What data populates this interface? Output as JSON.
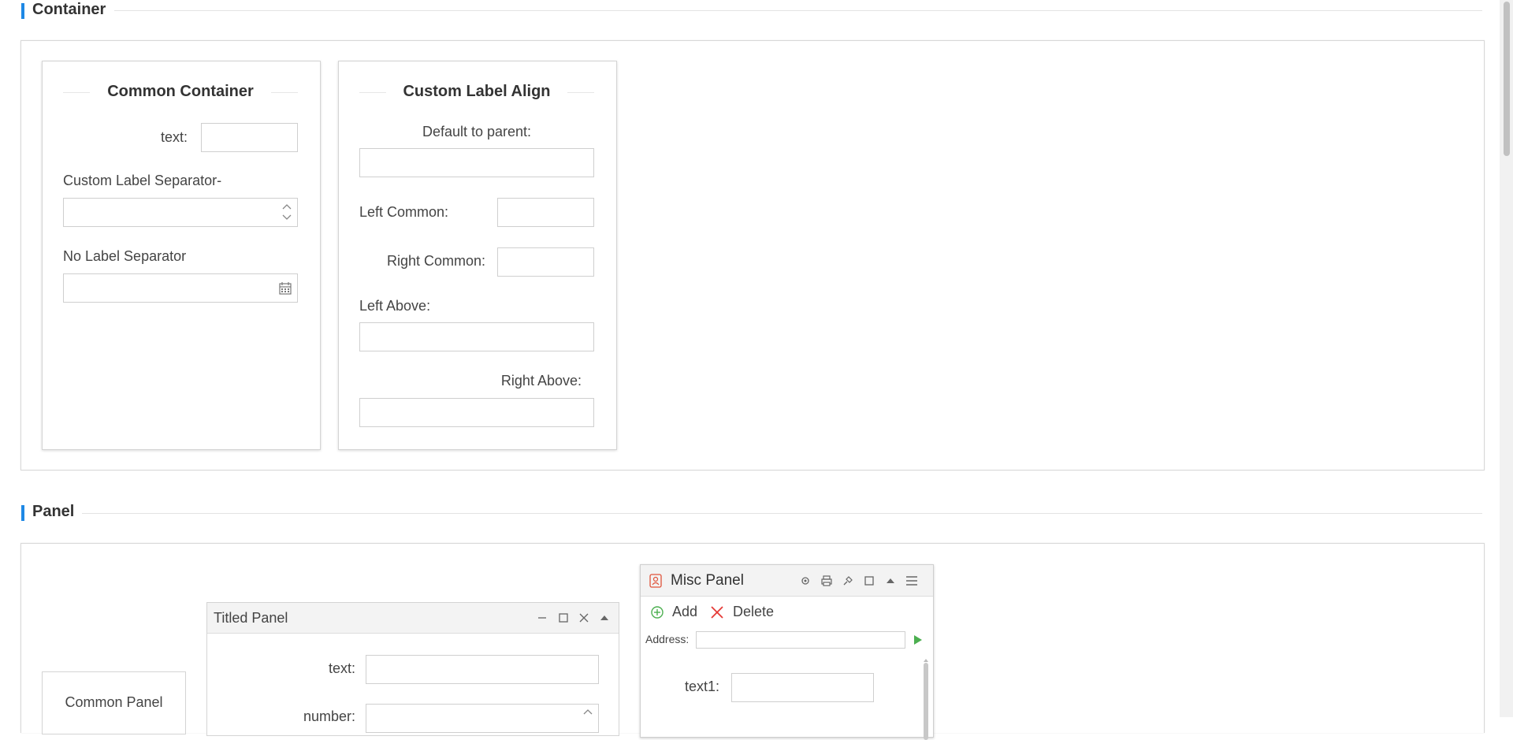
{
  "container_section": {
    "title": "Container"
  },
  "common_container": {
    "title": "Common Container",
    "text_label": "text:",
    "custom_sep_label": "Custom Label Separator-",
    "no_sep_label": "No Label Separator"
  },
  "custom_label_align": {
    "title": "Custom Label Align",
    "default_label": "Default to parent:",
    "left_common_label": "Left Common:",
    "right_common_label": "Right Common:",
    "left_above_label": "Left Above:",
    "right_above_label": "Right Above:"
  },
  "panel_section": {
    "title": "Panel"
  },
  "common_panel": {
    "title": "Common Panel"
  },
  "titled_panel": {
    "title": "Titled Panel",
    "text_label": "text:",
    "number_label": "number:"
  },
  "misc_panel": {
    "title": "Misc Panel",
    "add_label": "Add",
    "delete_label": "Delete",
    "address_label": "Address:",
    "text1_label": "text1:"
  },
  "colors": {
    "accent": "#1e88e5",
    "add_green": "#4caf50",
    "delete_red": "#e53935"
  }
}
